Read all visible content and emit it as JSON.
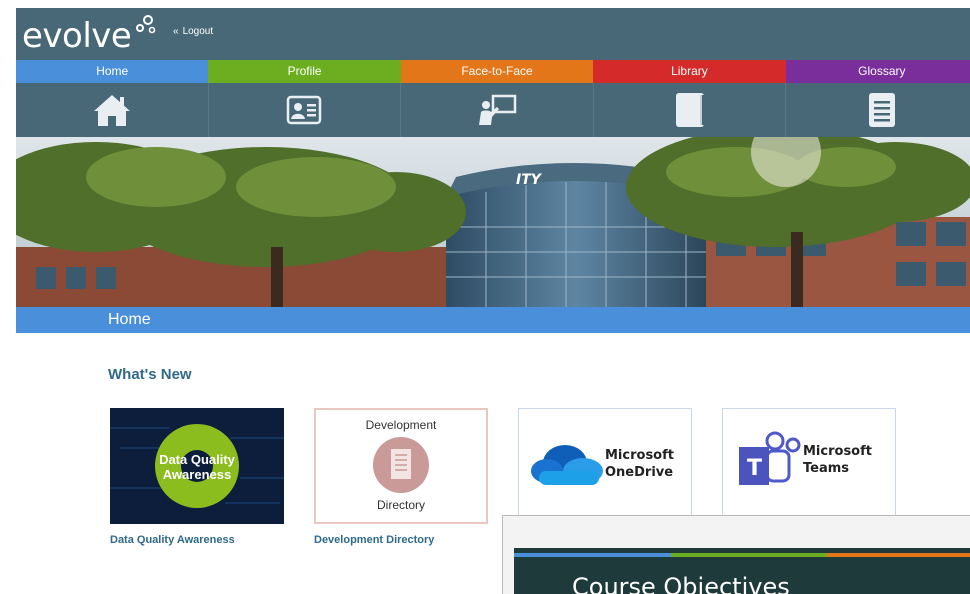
{
  "header": {
    "logo_text": "evolve",
    "logout_label": "Logout",
    "logout_chevron": "«"
  },
  "nav": {
    "tabs": [
      {
        "label": "Home",
        "color": "#4a8fd9"
      },
      {
        "label": "Profile",
        "color": "#6cae1f"
      },
      {
        "label": "Face-to-Face",
        "color": "#e4761a"
      },
      {
        "label": "Library",
        "color": "#d42a2a"
      },
      {
        "label": "Glossary",
        "color": "#7a2e9c"
      }
    ],
    "icons": [
      "home-icon",
      "profile-card-icon",
      "presenter-icon",
      "book-icon",
      "document-icon"
    ]
  },
  "hero": {
    "sign_text": "ITY"
  },
  "breadcrumb": {
    "label": "Home"
  },
  "whats_new": {
    "title": "What's New",
    "cards": [
      {
        "caption": "Data Quality Awareness",
        "image_text": [
          "Data Quality",
          "Awareness"
        ]
      },
      {
        "caption": "Development Directory",
        "image_top": "Development",
        "image_bottom": "Directory"
      },
      {
        "caption": "",
        "image_text": [
          "Microsoft",
          "OneDrive"
        ]
      },
      {
        "caption": "",
        "image_text": [
          "Microsoft",
          "Teams"
        ]
      }
    ]
  },
  "popup": {
    "title": "Course Objectives"
  }
}
